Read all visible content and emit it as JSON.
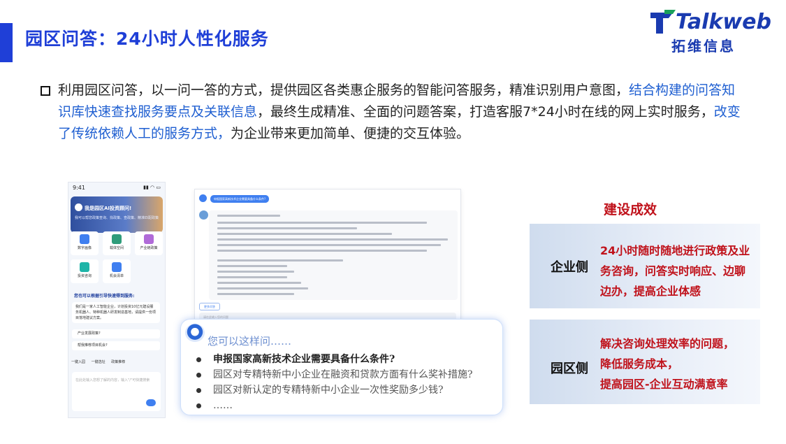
{
  "header": {
    "title": "园区问答：24小时人性化服务",
    "logo_word": "Talkweb",
    "logo_cn": "拓维信息"
  },
  "paragraph": {
    "part1": "利用园区问答，以一问一答的方式，提供园区各类惠企服务的智能问答服务，精准识别用户意图，",
    "part2_hl": "结合构建的问答知识库快速查找服务要点及关联信息",
    "part3": "，最终生成精准、全面的问题答案，打造客服7*24小时在线的网上实时服务，",
    "part4_hl": "改变了传统依赖人工的服务方式，",
    "part5": "为企业带来更加简单、便捷的交互体验。"
  },
  "phone": {
    "time": "9:41",
    "banner_title": "我是园区AI投资顾问!",
    "banner_sub": "我可以帮您政策查询、找政策、查政策、精准匹配政策",
    "tiles": [
      "数字画像",
      "载体空间",
      "产业链政策",
      "投资咨询",
      "机会清单"
    ],
    "questions_title": "您也可以根据引导快速得到服务:",
    "card_text": "我们是一家人工智能企业，计划投资10亿元建设服务机器人、特种机器人研发制造基地，请提供一份项目落地建议方案。",
    "rows": [
      "产业发展政策?",
      "帮我推荐项目机会?"
    ],
    "tools": [
      "一键入园",
      "一键选址",
      "政策推荐"
    ],
    "input_placeholder": "在此处输入您想了解的内容，输入\"/\"可快捷搜索"
  },
  "chat": {
    "question": "申报国家高新技术企业需要具备什么条件?",
    "more_label": "更多问答",
    "input_placeholder": "请在此输入您的问题"
  },
  "suggestions": {
    "title": "您可以这样问……",
    "items": [
      "申报国家高新技术企业需要具备什么条件?",
      "园区对专精特新中小企业在融资和贷款方面有什么奖补措施?",
      "园区对新认定的专精特新中小企业一次性奖励多少钱?",
      "……"
    ]
  },
  "results": {
    "title": "建设成效",
    "enterprise": {
      "label": "企业侧",
      "lines": [
        "24小时随时随地进行政策及业",
        "务咨询，问答实时响应、边聊",
        "边办，提高企业体感"
      ]
    },
    "park": {
      "label": "园区侧",
      "lines": [
        "解决咨询处理效率的问题，",
        "降低服务成本，",
        "提高园区-企业互动满意率"
      ]
    }
  }
}
